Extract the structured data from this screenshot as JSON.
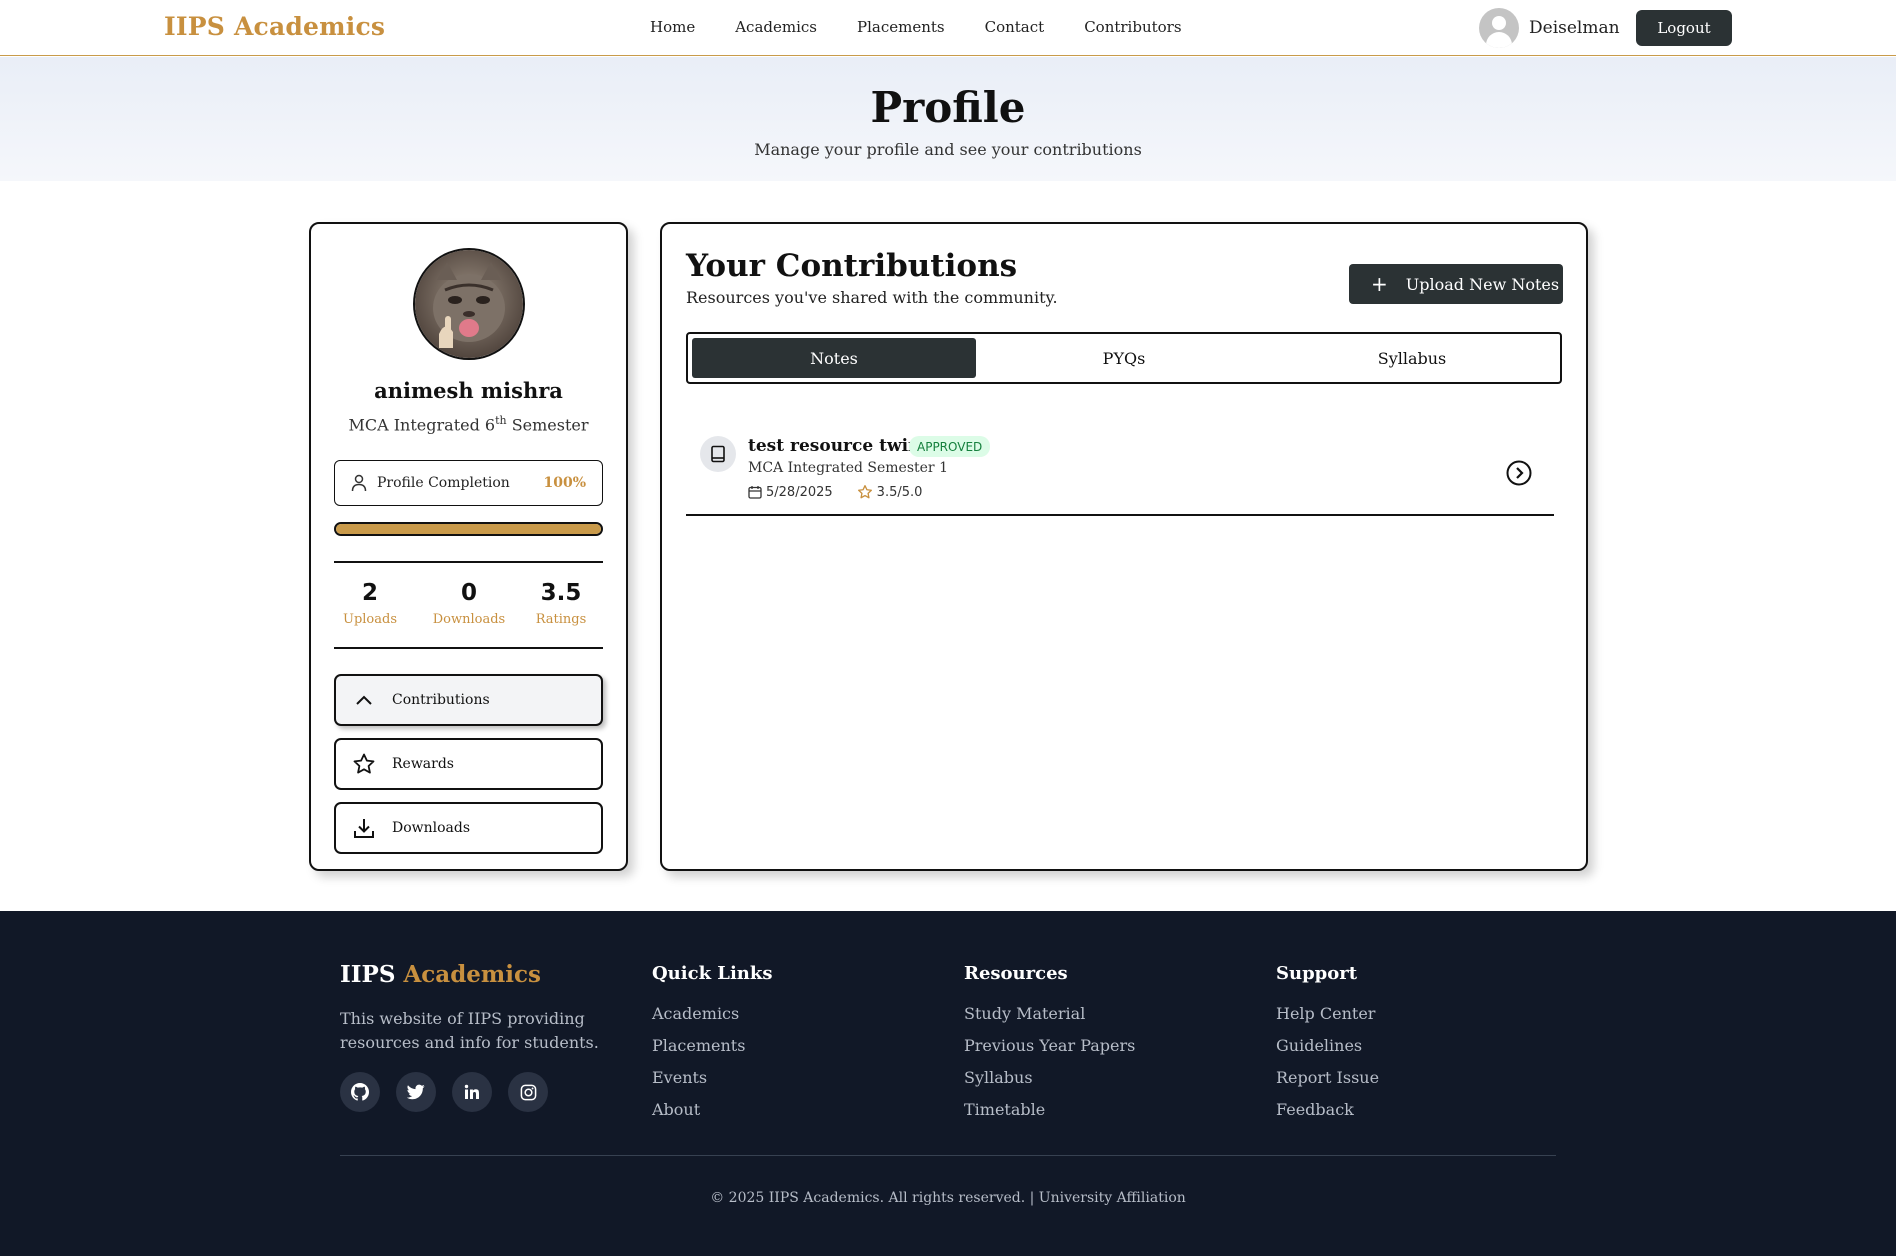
{
  "nav": {
    "brand": "IIPS Academics",
    "links": [
      "Home",
      "Academics",
      "Placements",
      "Contact",
      "Contributors"
    ],
    "username": "Deiselman",
    "logout_label": "Logout"
  },
  "hero": {
    "title": "Profile",
    "subtitle": "Manage your profile and see your contributions"
  },
  "profile": {
    "name": "animesh mishra",
    "program": "MCA Integrated 6",
    "program_sup": "th",
    "program_suffix": " Semester",
    "completion_label": "Profile Completion",
    "completion_value": "100%",
    "completion_fraction": 1.0,
    "stats": [
      {
        "value": "2",
        "label": "Uploads"
      },
      {
        "value": "0",
        "label": "Downloads"
      },
      {
        "value": "3.5",
        "label": "Ratings"
      }
    ],
    "menu": [
      {
        "label": "Contributions",
        "icon": "chevron-up-icon",
        "active": true
      },
      {
        "label": "Rewards",
        "icon": "star-icon",
        "active": false
      },
      {
        "label": "Downloads",
        "icon": "download-icon",
        "active": false
      }
    ]
  },
  "contributions": {
    "title": "Your Contributions",
    "subtitle": "Resources you've shared with the community.",
    "upload_label": "Upload New Notes",
    "tabs": [
      "Notes",
      "PYQs",
      "Syllabus"
    ],
    "active_tab": "Notes",
    "items": [
      {
        "title": "test resource twin",
        "status": "APPROVED",
        "course": "MCA Integrated Semester 1",
        "date": "5/28/2025",
        "rating": "3.5/5.0"
      }
    ]
  },
  "footer": {
    "brand_part1": "IIPS",
    "brand_part2": "Academics",
    "description": "This website of IIPS providing resources and info for students.",
    "socials": [
      "github-icon",
      "twitter-icon",
      "linkedin-icon",
      "instagram-icon"
    ],
    "columns": [
      {
        "heading": "Quick Links",
        "links": [
          "Academics",
          "Placements",
          "Events",
          "About"
        ]
      },
      {
        "heading": "Resources",
        "links": [
          "Study Material",
          "Previous Year Papers",
          "Syllabus",
          "Timetable"
        ]
      },
      {
        "heading": "Support",
        "links": [
          "Help Center",
          "Guidelines",
          "Report Issue",
          "Feedback"
        ]
      }
    ],
    "copyright": "© 2025 IIPS Academics. All rights reserved. | University Affiliation"
  },
  "colors": {
    "accent_gold": "#c8903f",
    "dark_button": "#2b3234",
    "footer_bg": "#111827",
    "approved_bg": "#dcfce7",
    "approved_text": "#15803d"
  }
}
